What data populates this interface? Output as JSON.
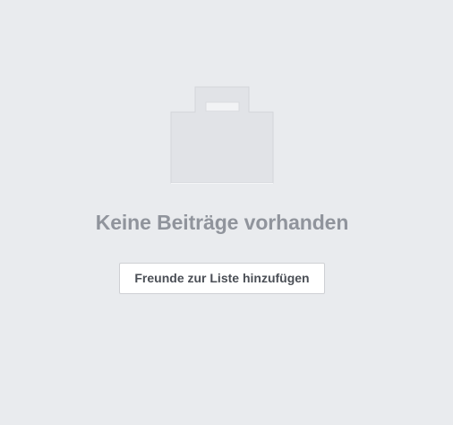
{
  "empty_state": {
    "icon": "bag-icon",
    "title": "Keine Beiträge vorhanden",
    "action_label": "Freunde zur Liste hinzufügen"
  },
  "colors": {
    "background": "#e9ebee",
    "icon_fill": "#e1e3e7",
    "icon_border": "#d4d6da",
    "title_text": "#90949c",
    "button_text": "#4b4f56",
    "button_border": "#ced0d4"
  }
}
